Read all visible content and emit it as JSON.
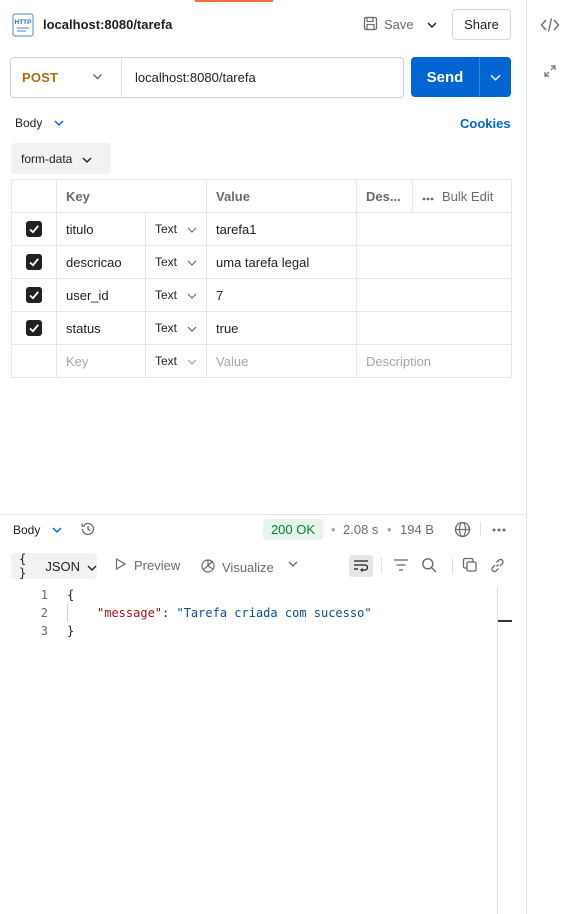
{
  "header": {
    "method_badge": "HTTP",
    "title": "localhost:8080/tarefa",
    "save_label": "Save",
    "share_label": "Share"
  },
  "request": {
    "method": "POST",
    "url": "localhost:8080/tarefa",
    "send_label": "Send"
  },
  "tabs": {
    "body_label": "Body",
    "cookies_label": "Cookies",
    "body_type": "form-data"
  },
  "table": {
    "headers": {
      "key": "Key",
      "value": "Value",
      "description": "Des...",
      "bulk_edit": "Bulk Edit"
    },
    "rows": [
      {
        "checked": true,
        "key": "titulo",
        "type": "Text",
        "value": "tarefa1",
        "description": ""
      },
      {
        "checked": true,
        "key": "descricao",
        "type": "Text",
        "value": "uma tarefa legal",
        "description": ""
      },
      {
        "checked": true,
        "key": "user_id",
        "type": "Text",
        "value": "7",
        "description": ""
      },
      {
        "checked": true,
        "key": "status",
        "type": "Text",
        "value": "true",
        "description": ""
      }
    ],
    "placeholder": {
      "key": "Key",
      "type": "Text",
      "value": "Value",
      "description": "Description"
    }
  },
  "response": {
    "body_label": "Body",
    "status": "200 OK",
    "time": "2.08 s",
    "size": "194 B",
    "format_label": "JSON",
    "format_prefix": "{ }",
    "preview_label": "Preview",
    "visualize_label": "Visualize",
    "code_lines": [
      {
        "num": "1",
        "text": "{"
      },
      {
        "num": "2",
        "key": "\"message\"",
        "colon": ": ",
        "value": "\"Tarefa criada com sucesso\""
      },
      {
        "num": "3",
        "text": "}"
      }
    ]
  },
  "colors": {
    "accent": "#ff6c37",
    "send": "#0265d2",
    "method": "#a67011",
    "status_ok": "#007f31"
  }
}
